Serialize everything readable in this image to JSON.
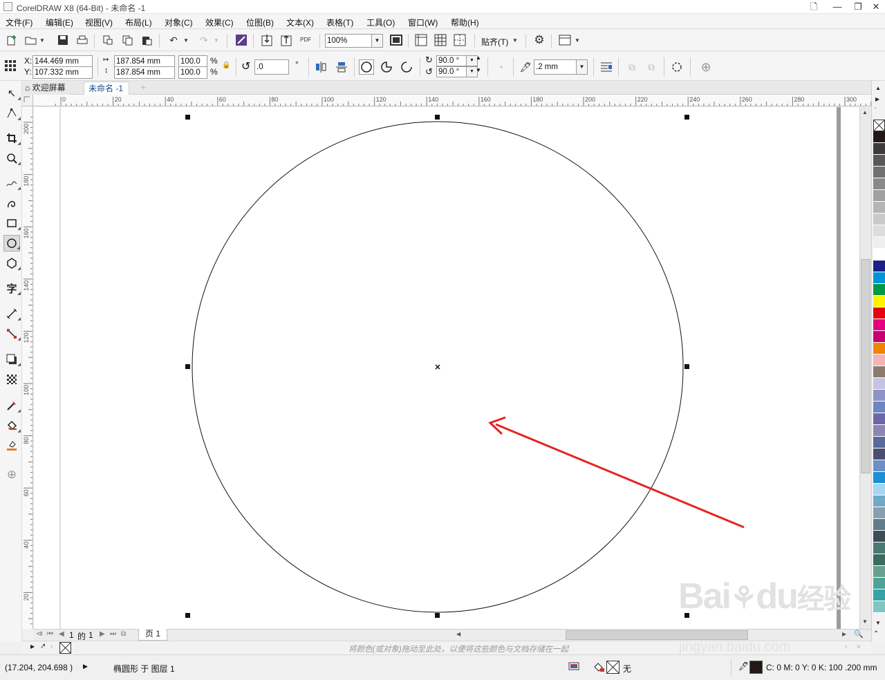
{
  "window": {
    "title": "CorelDRAW X8 (64-Bit) - 未命名 -1"
  },
  "menu": [
    {
      "label": "文件(F)"
    },
    {
      "label": "编辑(E)"
    },
    {
      "label": "视图(V)"
    },
    {
      "label": "布局(L)"
    },
    {
      "label": "对象(C)"
    },
    {
      "label": "效果(C)"
    },
    {
      "label": "位图(B)"
    },
    {
      "label": "文本(X)"
    },
    {
      "label": "表格(T)"
    },
    {
      "label": "工具(O)"
    },
    {
      "label": "窗口(W)"
    },
    {
      "label": "帮助(H)"
    }
  ],
  "standard_toolbar": {
    "zoom_value": "100%",
    "snap_label": "贴齐(T)",
    "pdf_label": "PDF"
  },
  "property_bar": {
    "x_label": "X:",
    "x_value": "144.469 mm",
    "y_label": "Y:",
    "y_value": "107.332 mm",
    "width_value": "187.854 mm",
    "height_value": "187.854 mm",
    "scale_w": "100.0",
    "scale_h": "100.0",
    "percent": "%",
    "rotation_value": ".0",
    "degree_symbol": "°",
    "start_angle": "90.0 °",
    "end_angle": "90.0 °",
    "outline_width": ".2 mm"
  },
  "doc_tabs": [
    {
      "label": "欢迎屏幕"
    },
    {
      "label": "未命名 -1"
    }
  ],
  "ruler": {
    "h_labels": [
      "0",
      "20",
      "40",
      "60",
      "80",
      "100",
      "120",
      "140",
      "160",
      "180",
      "200",
      "220",
      "240",
      "260",
      "280",
      "300"
    ],
    "v_labels": [
      "200",
      "180",
      "160",
      "140",
      "120",
      "100",
      "80",
      "60",
      "40",
      "20"
    ]
  },
  "page_nav": {
    "current": "1",
    "of_label": "的",
    "total": "1",
    "page_tab": "页 1"
  },
  "palette_hint": "将颜色(或对象)拖动至此处，以便将这些颜色与文档存储在一起",
  "palette_colors": [
    "#231815",
    "#3e3a39",
    "#595757",
    "#727171",
    "#898989",
    "#9fa0a0",
    "#b5b5b6",
    "#c9caca",
    "#dcdddd",
    "#efefef",
    "#ffffff",
    "#1d2088",
    "#0094d8",
    "#009944",
    "#fff100",
    "#e60012",
    "#e4007f",
    "#c6006f",
    "#f08300",
    "#f3b4b4",
    "#8c7b6b",
    "#c5c3e0",
    "#8e93c8",
    "#6f85c2",
    "#6c67a9",
    "#8e85b5",
    "#586a99",
    "#4b4e6e",
    "#6e8ec8",
    "#1b8ed4",
    "#a4d6f4",
    "#6fa9c7",
    "#889fad",
    "#5f7c8a",
    "#3c4d56",
    "#4a7a72",
    "#3d6b5e",
    "#68a08f",
    "#4fa397",
    "#35a3a6",
    "#7fc6c2"
  ],
  "status": {
    "coords": "(17.204, 204.698 )",
    "object_info": "椭圆形 于 图层 1",
    "fill_label": "无",
    "outline_info": "C: 0 M: 0 Y: 0 K: 100  .200 mm"
  },
  "watermark": {
    "brand": "Bai",
    "brand_tail": "du",
    "suffix": "经验",
    "url": "jingyan.baidu.com"
  }
}
